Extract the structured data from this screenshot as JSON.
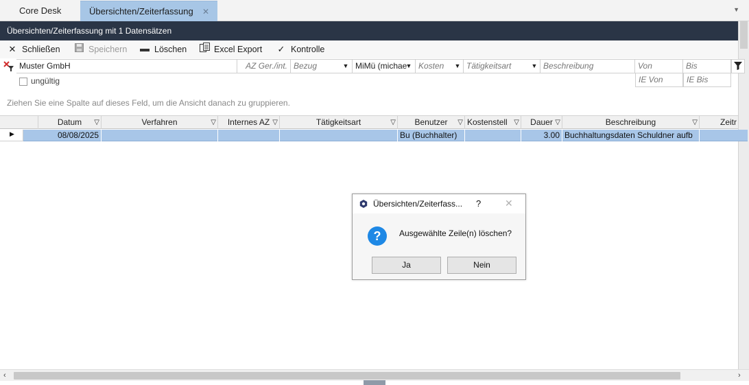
{
  "tabs": [
    {
      "label": "Core Desk",
      "active": false
    },
    {
      "label": "Übersichten/Zeiterfassung",
      "active": true
    }
  ],
  "header": {
    "title": "Übersichten/Zeiterfassung mit 1 Datensätzen"
  },
  "toolbar": {
    "close_label": "Schließen",
    "save_label": "Speichern",
    "delete_label": "Löschen",
    "export_label": "Excel Export",
    "check_label": "Kontrolle"
  },
  "filters": {
    "client_value": "Muster GmbH",
    "az_placeholder": "AZ Ger./int.",
    "bezug_placeholder": "Bezug",
    "user_value": "MiMü (michae",
    "kosten_placeholder": "Kosten",
    "taetigkeit_placeholder": "Tätigkeitsart",
    "beschreibung_placeholder": "Beschreibung",
    "von_placeholder": "Von",
    "bis_placeholder": "Bis",
    "ie_von_placeholder": "IE Von",
    "ie_bis_placeholder": "IE Bis",
    "invalid_label": "ungültig"
  },
  "group_hint": "Ziehen Sie eine Spalte auf dieses Feld, um die Ansicht danach zu gruppieren.",
  "grid": {
    "columns": [
      "Datum",
      "Verfahren",
      "Internes AZ",
      "Tätigkeitsart",
      "Benutzer",
      "Kostenstell",
      "Dauer",
      "Beschreibung",
      "Zeitr"
    ],
    "rows": [
      {
        "datum": "08/08/2025",
        "verfahren": "",
        "internes_az": "",
        "taetigkeitsart": "",
        "benutzer": "Bu (Buchhalter)",
        "kostenstelle": "",
        "dauer": "3.00",
        "beschreibung": "Buchhaltungsdaten Schuldner aufb",
        "zeitr": ""
      }
    ]
  },
  "dialog": {
    "title": "Übersichten/Zeiterfass...",
    "help": "?",
    "message": "Ausgewählte Zeile(n) löschen?",
    "yes_label": "Ja",
    "no_label": "Nein"
  },
  "colors": {
    "titlebar": "#2a3546",
    "selection": "#a8c6e8",
    "active_tab": "#a7c6e6",
    "question_icon": "#1e88e5"
  }
}
